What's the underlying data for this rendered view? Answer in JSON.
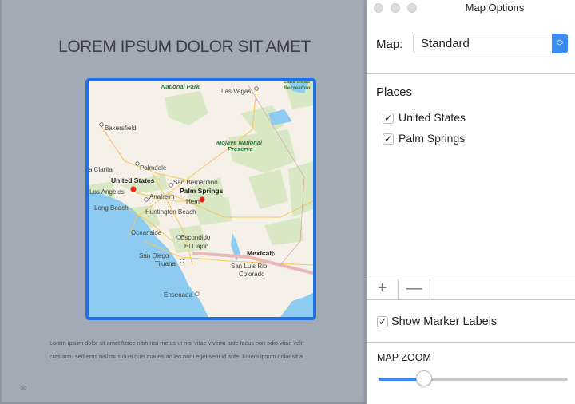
{
  "document": {
    "title": "LOREM IPSUM DOLOR SIT AMET",
    "body_lines": [
      "Lorem ipsum dolor sit amet fusce nibh nisi metus ut nisl vitae viverra ante lacus non odio vitae velit",
      "cras arcu sed eros nisl mus duis quis mauris ac leo nam eget sem id ante. Lorem ipsum dolor sit a"
    ],
    "page_number": "50",
    "map_labels": {
      "national_park": "National Park",
      "las_vegas": "Las Vegas",
      "lake_mead": "Lake Mead",
      "recreation": "Recreation",
      "bakersfield": "Bakersfield",
      "mojave": "Mojave National",
      "preserve": "Preserve",
      "santa_clarita": "a Clarita",
      "palmdale": "Palmdale",
      "united_states": "United States",
      "los_angeles": "Los Angeles",
      "san_bernardino": "San Bernardino",
      "palm_springs": "Palm Springs",
      "anaheim": "Anaheim",
      "hemet": "Hem",
      "long_beach": "Long Beach",
      "huntington_beach": "Huntington Beach",
      "oceanside": "Oceanside",
      "escondido": "Escondido",
      "el_cajon": "El Cajon",
      "san_diego": "San Diego",
      "tijuana": "Tijuana",
      "mexicali": "Mexicali",
      "san_luis": "San Luis Rio",
      "colorado": "Colorado",
      "ensenada": "Ensenada"
    }
  },
  "panel": {
    "title": "Map Options",
    "map_label": "Map:",
    "map_select": "Standard",
    "places_heading": "Places",
    "places": [
      {
        "label": "United States",
        "checked": true
      },
      {
        "label": "Palm Springs",
        "checked": true
      }
    ],
    "add_label": "+",
    "remove_label": "—",
    "show_marker_labels": {
      "label": "Show Marker Labels",
      "checked": true
    },
    "zoom_heading": "MAP ZOOM",
    "zoom_value": 0.24,
    "accent": "#3b8cf0"
  }
}
